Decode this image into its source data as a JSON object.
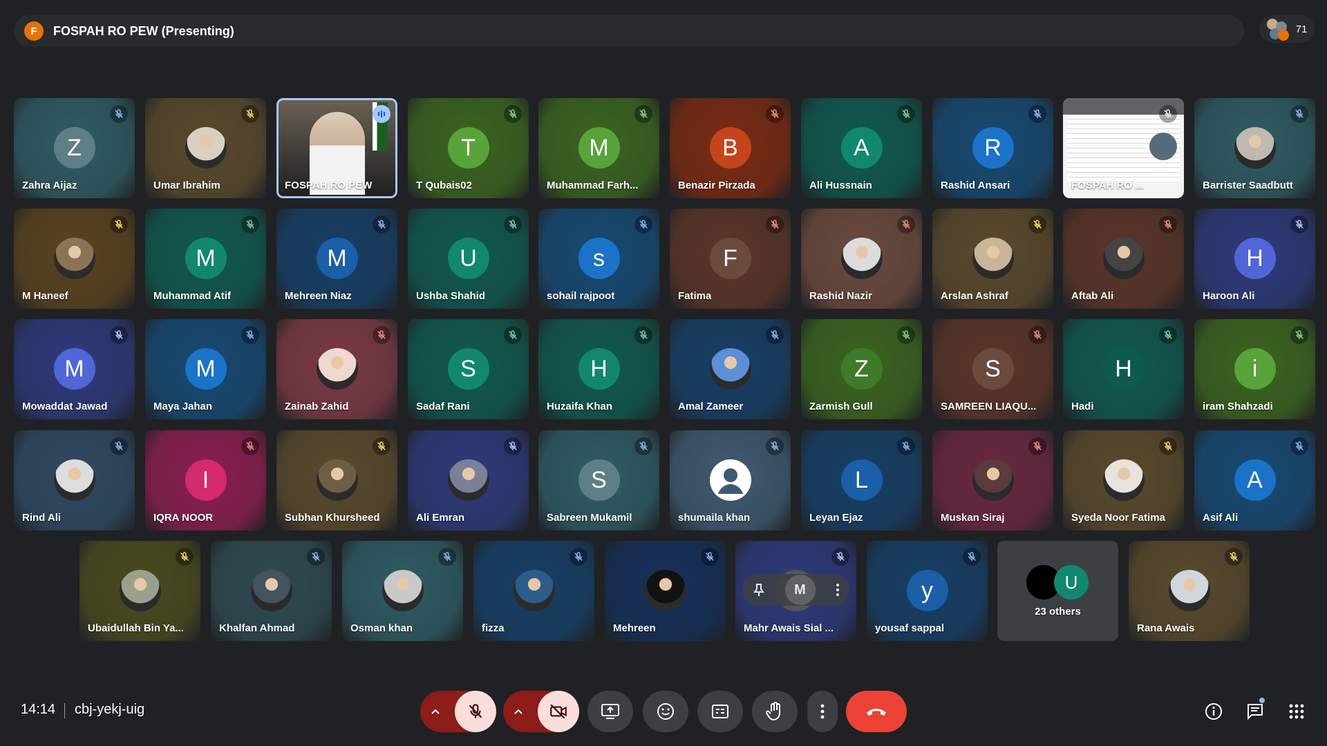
{
  "presenter": {
    "initial": "F",
    "title": "FOSPAH RO PEW (Presenting)"
  },
  "participant_count": "71",
  "tiles": [
    {
      "name": "Zahra Aijaz",
      "initial": "Z",
      "bg": "#2f5b63",
      "avatar": "#5f7f86",
      "mic": "#8ab4f8",
      "kind": "letter"
    },
    {
      "name": "Umar Ibrahim",
      "initial": "",
      "bg": "#5a4a2c",
      "avatar": "#d9d0c2",
      "mic": "#fdd663",
      "kind": "photo"
    },
    {
      "name": "FOSPAH RO PEW",
      "initial": "",
      "bg": "#3a3a3a",
      "avatar": "#9a8b74",
      "mic": "#8ab4f8",
      "kind": "video"
    },
    {
      "name": "T Qubais02",
      "initial": "T",
      "bg": "#3b6420",
      "avatar": "#58a33a",
      "mic": "#81c995",
      "kind": "letter"
    },
    {
      "name": "Muhammad Farh...",
      "initial": "M",
      "bg": "#3b6420",
      "avatar": "#58a33a",
      "mic": "#81c995",
      "kind": "letter"
    },
    {
      "name": "Benazir Pirzada",
      "initial": "B",
      "bg": "#7a2b13",
      "avatar": "#c5441c",
      "mic": "#f28b82",
      "kind": "letter"
    },
    {
      "name": "Ali Hussnain",
      "initial": "A",
      "bg": "#10594f",
      "avatar": "#12876f",
      "mic": "#81c995",
      "kind": "letter"
    },
    {
      "name": "Rashid Ansari",
      "initial": "R",
      "bg": "#174a73",
      "avatar": "#1a73c8",
      "mic": "#8ab4f8",
      "kind": "letter"
    },
    {
      "name": "FOSPAH RO ...",
      "initial": "",
      "bg": "#2f3034",
      "avatar": "#ffffff",
      "mic": "#e8eaed",
      "kind": "screen"
    },
    {
      "name": "Barrister Saadbutt",
      "initial": "",
      "bg": "#2f5b63",
      "avatar": "#bfb9b0",
      "mic": "#8ab4f8",
      "kind": "photo"
    },
    {
      "name": "M Haneef",
      "initial": "",
      "bg": "#5a4320",
      "avatar": "#8b7355",
      "mic": "#fdd663",
      "kind": "photo"
    },
    {
      "name": "Muhammad Atif",
      "initial": "M",
      "bg": "#10594f",
      "avatar": "#12876f",
      "mic": "#81c995",
      "kind": "letter"
    },
    {
      "name": "Mehreen Niaz",
      "initial": "M",
      "bg": "#173f66",
      "avatar": "#1a5fa8",
      "mic": "#8ab4f8",
      "kind": "letter"
    },
    {
      "name": "Ushba Shahid",
      "initial": "U",
      "bg": "#10594f",
      "avatar": "#12876f",
      "mic": "#81c995",
      "kind": "letter"
    },
    {
      "name": "sohail rajpoot",
      "initial": "s",
      "bg": "#174a73",
      "avatar": "#1a73c8",
      "mic": "#8ab4f8",
      "kind": "letter"
    },
    {
      "name": "Fatima",
      "initial": "F",
      "bg": "#5b3528",
      "avatar": "#6b4a3e",
      "mic": "#f28b82",
      "kind": "letter"
    },
    {
      "name": "Rashid Nazir",
      "initial": "",
      "bg": "#6b4a3e",
      "avatar": "#dcdcdc",
      "mic": "#f28b82",
      "kind": "photo"
    },
    {
      "name": "Arslan Ashraf",
      "initial": "",
      "bg": "#5a4a2c",
      "avatar": "#c9b59a",
      "mic": "#fdd663",
      "kind": "photo"
    },
    {
      "name": "Aftab Ali",
      "initial": "",
      "bg": "#5b3528",
      "avatar": "#444",
      "mic": "#f28b82",
      "kind": "photo"
    },
    {
      "name": "Haroon Ali",
      "initial": "H",
      "bg": "#2e3a7a",
      "avatar": "#5066d6",
      "mic": "#aecbfa",
      "kind": "letter"
    },
    {
      "name": "Mowaddat Jawad",
      "initial": "M",
      "bg": "#2e3a7a",
      "avatar": "#5066d6",
      "mic": "#aecbfa",
      "kind": "letter"
    },
    {
      "name": "Maya Jahan",
      "initial": "M",
      "bg": "#174a73",
      "avatar": "#1a73c8",
      "mic": "#8ab4f8",
      "kind": "letter"
    },
    {
      "name": "Zainab Zahid",
      "initial": "",
      "bg": "#7a3a45",
      "avatar": "#f0d8d0",
      "mic": "#f28b82",
      "kind": "photo"
    },
    {
      "name": "Sadaf Rani",
      "initial": "S",
      "bg": "#10594f",
      "avatar": "#12876f",
      "mic": "#81c995",
      "kind": "letter"
    },
    {
      "name": "Huzaifa Khan",
      "initial": "H",
      "bg": "#10594f",
      "avatar": "#12876f",
      "mic": "#81c995",
      "kind": "letter"
    },
    {
      "name": "Amal Zameer",
      "initial": "",
      "bg": "#173f66",
      "avatar": "#5c8fd6",
      "mic": "#8ab4f8",
      "kind": "photo"
    },
    {
      "name": "Zarmish Gull",
      "initial": "Z",
      "bg": "#3b6420",
      "avatar": "#3f7a2a",
      "mic": "#81c995",
      "kind": "letter"
    },
    {
      "name": "SAMREEN LIAQU...",
      "initial": "S",
      "bg": "#5b3528",
      "avatar": "#6b4a3e",
      "mic": "#f28b82",
      "kind": "letter"
    },
    {
      "name": "Hadi",
      "initial": "H",
      "bg": "#10594f",
      "avatar": "#0f5a4e",
      "mic": "#81c995",
      "kind": "letter"
    },
    {
      "name": "iram Shahzadi",
      "initial": "i",
      "bg": "#3b6420",
      "avatar": "#58a33a",
      "mic": "#81c995",
      "kind": "letter"
    },
    {
      "name": "Rind Ali",
      "initial": "",
      "bg": "#2f4a63",
      "avatar": "#ddd",
      "mic": "#8ab4f8",
      "kind": "photo"
    },
    {
      "name": "IQRA NOOR",
      "initial": "I",
      "bg": "#8a1f4f",
      "avatar": "#d42a6e",
      "mic": "#f28b82",
      "kind": "letter"
    },
    {
      "name": "Subhan Khursheed",
      "initial": "",
      "bg": "#5a4a2c",
      "avatar": "#6d5f45",
      "mic": "#fdd663",
      "kind": "photo"
    },
    {
      "name": "Ali Emran",
      "initial": "",
      "bg": "#2e3a7a",
      "avatar": "#7b8099",
      "mic": "#aecbfa",
      "kind": "photo"
    },
    {
      "name": "Sabreen Mukamil",
      "initial": "S",
      "bg": "#2f5b63",
      "avatar": "#5f7f86",
      "mic": "#8ab4f8",
      "kind": "letter"
    },
    {
      "name": "shumaila khan",
      "initial": "",
      "bg": "#3e5a70",
      "avatar": "#ffffff",
      "mic": "#8ab4f8",
      "kind": "default"
    },
    {
      "name": "Leyan Ejaz",
      "initial": "L",
      "bg": "#173f66",
      "avatar": "#1a5fa8",
      "mic": "#8ab4f8",
      "kind": "letter"
    },
    {
      "name": "Muskan Siraj",
      "initial": "",
      "bg": "#6a2840",
      "avatar": "#5b3b3b",
      "mic": "#f28b82",
      "kind": "photo"
    },
    {
      "name": "Syeda Noor Fatima",
      "initial": "",
      "bg": "#5a4a2c",
      "avatar": "#e8e3dc",
      "mic": "#fdd663",
      "kind": "photo"
    },
    {
      "name": "Asif Ali",
      "initial": "A",
      "bg": "#174a73",
      "avatar": "#1a73c8",
      "mic": "#8ab4f8",
      "kind": "letter"
    },
    {
      "name": "Ubaidullah Bin Ya...",
      "initial": "",
      "bg": "#4a4a20",
      "avatar": "#9aa08a",
      "mic": "#fdd663",
      "kind": "photo"
    },
    {
      "name": "Khalfan Ahmad",
      "initial": "",
      "bg": "#2f4a52",
      "avatar": "#44535e",
      "mic": "#8ab4f8",
      "kind": "photo"
    },
    {
      "name": "Osman khan",
      "initial": "",
      "bg": "#2f5b63",
      "avatar": "#c8c8c8",
      "mic": "#8ab4f8",
      "kind": "photo"
    },
    {
      "name": "fizza",
      "initial": "",
      "bg": "#173f66",
      "avatar": "#2d5d8a",
      "mic": "#8ab4f8",
      "kind": "photo"
    },
    {
      "name": "Mehreen",
      "initial": "",
      "bg": "#15305a",
      "avatar": "#111",
      "mic": "#8ab4f8",
      "kind": "photo"
    },
    {
      "name": "Mahr Awais Sial ...",
      "initial": "",
      "bg": "#2e3a7a",
      "avatar": "#666",
      "mic": "#aecbfa",
      "kind": "hover"
    },
    {
      "name": "yousaf sappal",
      "initial": "y",
      "bg": "#173f66",
      "avatar": "#1a5fa8",
      "mic": "#8ab4f8",
      "kind": "letter"
    },
    {
      "name": "23 others",
      "initial": "U",
      "bg": "#3c4043",
      "avatar": "#12876f",
      "mic": "",
      "kind": "others"
    },
    {
      "name": "Rana Awais",
      "initial": "",
      "bg": "#5a4a2c",
      "avatar": "#cfd6dc",
      "mic": "#fdd663",
      "kind": "photo"
    }
  ],
  "bottom": {
    "time": "14:14",
    "meeting_code": "cbj-yekj-uig"
  },
  "colors": {
    "accent": "#a8c7fa",
    "end_call": "#ea4335",
    "muted": "#f9dedc"
  }
}
